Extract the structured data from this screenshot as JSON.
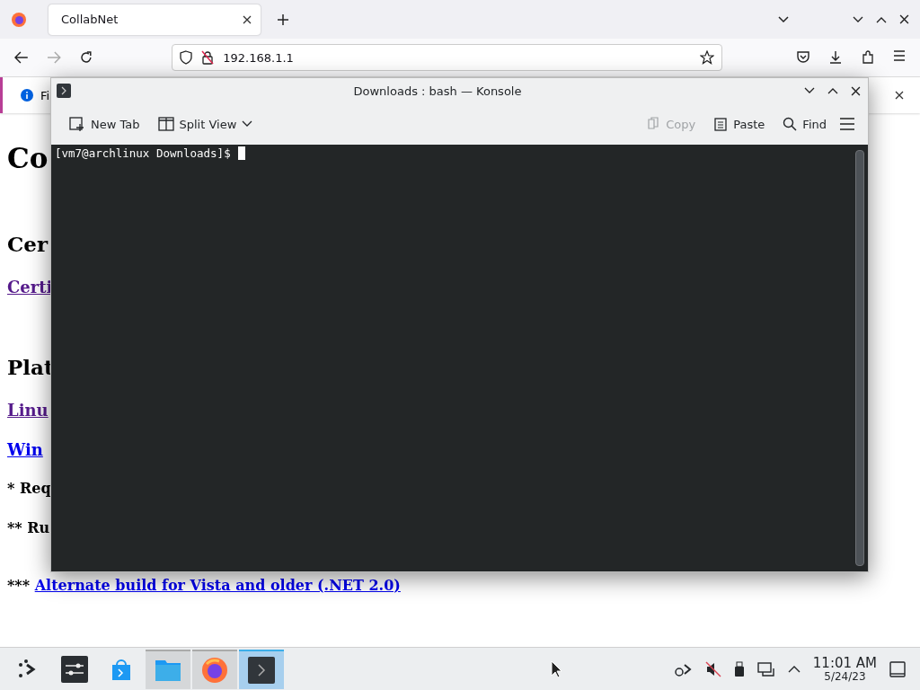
{
  "browser": {
    "tabs": [
      {
        "label": "CollabNet",
        "selected": true
      }
    ],
    "address": "192.168.1.1",
    "notification": "Fi"
  },
  "page": {
    "blocks": [
      {
        "kind": "h1",
        "text": "Co"
      },
      {
        "kind": "h2",
        "text": "Cer"
      },
      {
        "kind": "link",
        "text": "Certi",
        "visited": true
      },
      {
        "kind": "h2",
        "text": "Plat"
      },
      {
        "kind": "link",
        "text": "Linu",
        "visited": true
      },
      {
        "kind": "link",
        "text": "Win",
        "visited": false
      },
      {
        "kind": "note",
        "text": "* Req"
      },
      {
        "kind": "note",
        "text": "** Ru"
      },
      {
        "kind": "notelink",
        "prefix": "***",
        "text": "Alternate build for Vista and older (.NET 2.0)",
        "visited": false
      }
    ]
  },
  "konsole": {
    "title": "Downloads : bash — Konsole",
    "toolbar": [
      {
        "label": "New Tab",
        "kind": "newtab",
        "disabled": false
      },
      {
        "label": "Split View",
        "kind": "split",
        "disabled": false
      }
    ],
    "toolbar_right": [
      {
        "label": "Copy",
        "kind": "copy",
        "disabled": true
      },
      {
        "label": "Paste",
        "kind": "paste",
        "disabled": false
      },
      {
        "label": "Find",
        "kind": "find",
        "disabled": false
      }
    ],
    "prompt": "[vm7@archlinux Downloads]$"
  },
  "taskbar": {
    "apps": [
      {
        "kind": "launcher",
        "selected": false
      },
      {
        "kind": "settings",
        "selected": false
      },
      {
        "kind": "store",
        "selected": false
      },
      {
        "kind": "files",
        "selected": true
      },
      {
        "kind": "firefox",
        "selected": true
      },
      {
        "kind": "terminal",
        "selected": true
      }
    ],
    "time": "11:01 AM",
    "date": "5/24/23"
  }
}
